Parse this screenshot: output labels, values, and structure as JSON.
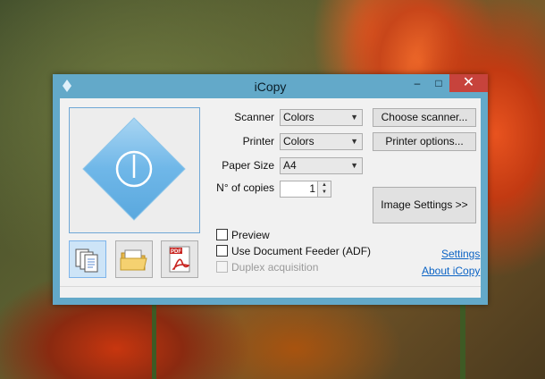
{
  "window": {
    "title": "iCopy",
    "minimize_glyph": "–",
    "maximize_glyph": "□",
    "close_glyph": "✕",
    "accent_color": "#63a9c9"
  },
  "icons": {
    "app": "diamond-icon",
    "power": "power-icon",
    "copy": "copy-documents-icon",
    "folder": "open-folder-icon",
    "pdf": "pdf-icon",
    "pdf_label": "PDF"
  },
  "form": {
    "scanner_label": "Scanner",
    "scanner_value": "Colors",
    "printer_label": "Printer",
    "printer_value": "Colors",
    "paper_size_label": "Paper Size",
    "paper_size_value": "A4",
    "copies_label": "N° of copies",
    "copies_value": "1"
  },
  "buttons": {
    "choose_scanner": "Choose scanner...",
    "printer_options": "Printer options...",
    "image_settings": "Image Settings >>"
  },
  "options": {
    "preview": "Preview",
    "adf": "Use Document Feeder (ADF)",
    "duplex": "Duplex acquisition"
  },
  "links": {
    "settings": "Settings",
    "about": "About iCopy"
  }
}
